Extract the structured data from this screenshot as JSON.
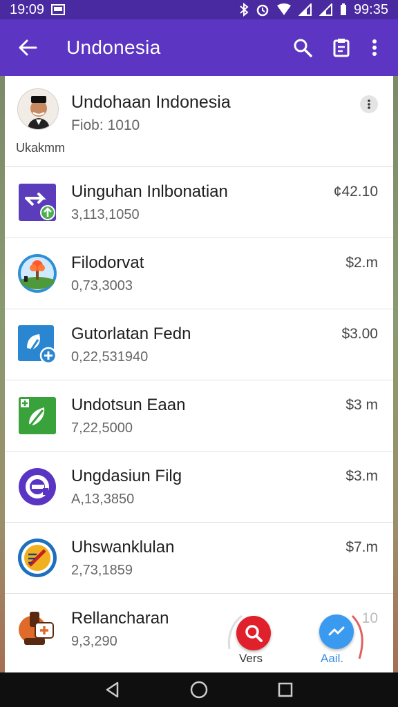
{
  "status_bar": {
    "time_left": "19:09",
    "time_right": "99:35"
  },
  "app_bar": {
    "title": "Undonesia"
  },
  "header_card": {
    "name": "Undohaan Indonesia",
    "subtitle": "Fiob: 1010",
    "caption": "Ukakmm"
  },
  "apps": [
    {
      "name": "Uinguhan Inlbonatian",
      "downloads": "3,113,1050",
      "price": "¢42.10",
      "icon": "launch-arrow-icon",
      "color": "#5b3dbb"
    },
    {
      "name": "Filodorvat",
      "downloads": "0,73,3003",
      "price": "$2.m",
      "icon": "landscape-tree-icon",
      "color": "#2f8fd6"
    },
    {
      "name": "Gutorlatan Fedn",
      "downloads": "0,22,531940",
      "price": "$3.00",
      "icon": "leaf-add-icon",
      "color": "#2a86d0"
    },
    {
      "name": "Undotsun Eaan",
      "downloads": "7,22,5000",
      "price": "$3 m",
      "icon": "leaf-badge-icon",
      "color": "#3aa23a"
    },
    {
      "name": "Ungdasiun Filg",
      "downloads": "A,13,3850",
      "price": "$3.m",
      "icon": "circle-e-icon",
      "color": "#5a35c4"
    },
    {
      "name": "Uhswanklulan",
      "downloads": "2,73,1859",
      "price": "$7.m",
      "icon": "emblem-seal-icon",
      "color": "#f0b020"
    },
    {
      "name": "Rellancharan",
      "downloads": "9,3,290",
      "price": "10",
      "icon": "puzzle-hand-icon",
      "color": "#e06a2a"
    }
  ],
  "fabs": {
    "search_label": "Vers",
    "chart_label": "Aail."
  }
}
